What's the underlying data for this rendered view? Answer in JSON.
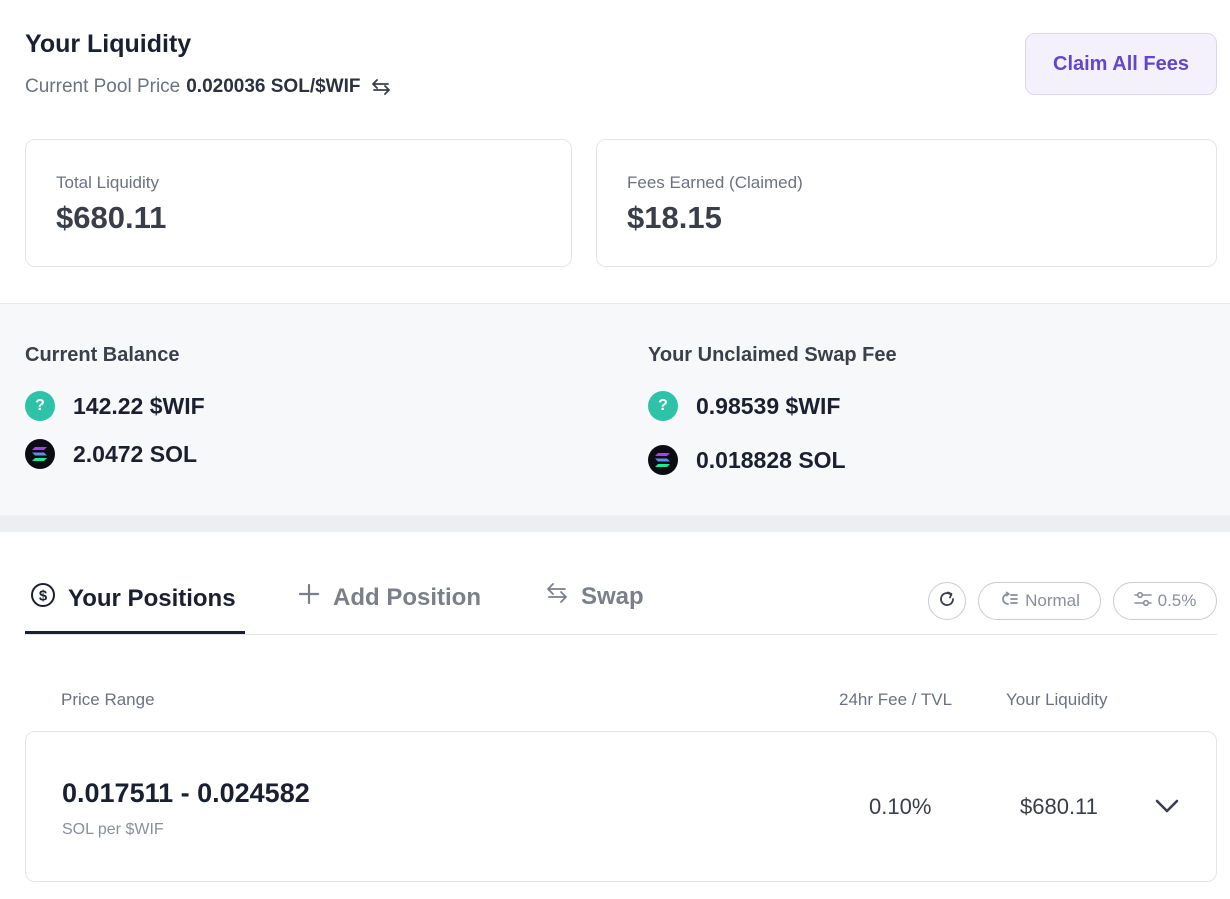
{
  "header": {
    "title": "Your Liquidity",
    "pool_price_label": "Current Pool Price",
    "pool_price_value": "0.020036 SOL/$WIF",
    "claim_button": "Claim All Fees"
  },
  "stats": {
    "total_liquidity_label": "Total Liquidity",
    "total_liquidity_value": "$680.11",
    "fees_earned_label": "Fees Earned (Claimed)",
    "fees_earned_value": "$18.15"
  },
  "balance": {
    "title": "Current Balance",
    "items": [
      {
        "icon": "wif-token-icon",
        "value": "142.22 $WIF"
      },
      {
        "icon": "sol-token-icon",
        "value": "2.0472 SOL"
      }
    ]
  },
  "unclaimed": {
    "title": "Your Unclaimed Swap Fee",
    "items": [
      {
        "icon": "wif-token-icon",
        "value": "0.98539 $WIF"
      },
      {
        "icon": "sol-token-icon",
        "value": "0.018828 SOL"
      }
    ]
  },
  "tabs": {
    "positions": "Your Positions",
    "add": "Add Position",
    "swap": "Swap"
  },
  "controls": {
    "mode": "Normal",
    "slippage": "0.5%"
  },
  "table": {
    "headers": {
      "price_range": "Price Range",
      "fee_tvl": "24hr Fee / TVL",
      "liquidity": "Your Liquidity"
    },
    "rows": [
      {
        "range": "0.017511 - 0.024582",
        "unit": "SOL per $WIF",
        "fee_tvl": "0.10%",
        "liquidity": "$680.11"
      }
    ]
  },
  "colors": {
    "accent": "#6248c8",
    "accent_bg": "#f4f1fd",
    "wif_token": "#2cc3a9",
    "sol_token": "#0c0c12"
  }
}
